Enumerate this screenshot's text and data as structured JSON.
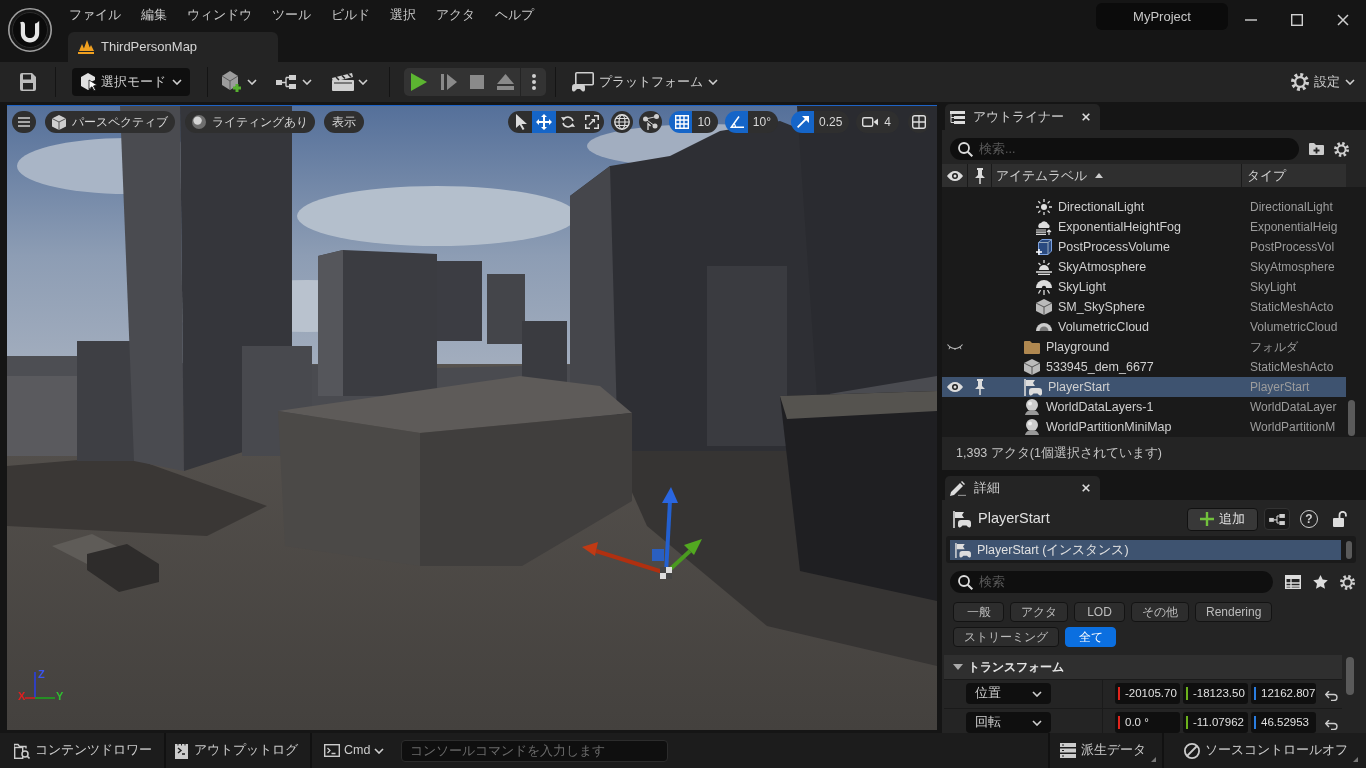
{
  "window": {
    "title": "MyProject",
    "menu": [
      "ファイル",
      "編集",
      "ウィンドウ",
      "ツール",
      "ビルド",
      "選択",
      "アクタ",
      "ヘルプ"
    ]
  },
  "document_tabs": [
    {
      "label": "ThirdPersonMap",
      "selected": true
    }
  ],
  "toolbar": {
    "mode": "選択モード",
    "platforms": "プラットフォーム",
    "settings": "設定"
  },
  "viewport": {
    "view_mode": "パースペクティブ",
    "lighting": "ライティングあり",
    "show": "表示",
    "tools": [
      {
        "kind": "select",
        "selected": false
      },
      {
        "kind": "move",
        "selected": true
      },
      {
        "kind": "rotate",
        "selected": false
      },
      {
        "kind": "scale",
        "selected": false
      }
    ],
    "grid_snap": {
      "on": true,
      "value": "10"
    },
    "angle_snap": {
      "on": true,
      "value": "10°"
    },
    "scale_snap": {
      "on": true,
      "value": "0.25"
    },
    "camera_speed": "4",
    "axes": {
      "x": "X",
      "y": "Y",
      "z": "Z"
    }
  },
  "outliner": {
    "tab": "アウトライナー",
    "search_placeholder": "検索...",
    "columns": [
      "アイテムラベル",
      "タイプ"
    ],
    "items": [
      {
        "children": [
          {
            "label": "DirectionalLight",
            "type": "DirectionalLight",
            "kind": "light",
            "selected": false,
            "hidden": false
          },
          {
            "label": "ExponentialHeightFog",
            "type": "ExponentialHeig",
            "kind": "fog",
            "selected": false,
            "hidden": false
          },
          {
            "label": "PostProcessVolume",
            "type": "PostProcessVol",
            "kind": "volume",
            "selected": false,
            "hidden": false
          },
          {
            "label": "SkyAtmosphere",
            "type": "SkyAtmosphere",
            "kind": "atmosphere",
            "selected": false,
            "hidden": false
          },
          {
            "label": "SkyLight",
            "type": "SkyLight",
            "kind": "skylight",
            "selected": false,
            "hidden": false
          },
          {
            "label": "SM_SkySphere",
            "type": "StaticMeshActo",
            "kind": "mesh",
            "selected": false,
            "hidden": false
          },
          {
            "label": "VolumetricCloud",
            "type": "VolumetricCloud",
            "kind": "cloud",
            "selected": false,
            "hidden": false
          }
        ]
      },
      {
        "label": "Playground",
        "type": "フォルダ",
        "kind": "folder",
        "selected": false,
        "hidden": true
      },
      {
        "label": "533945_dem_6677",
        "type": "StaticMeshActo",
        "kind": "mesh",
        "selected": false,
        "hidden": false
      },
      {
        "label": "PlayerStart",
        "type": "PlayerStart",
        "kind": "playerstart",
        "selected": true,
        "hidden": false
      },
      {
        "label": "WorldDataLayers-1",
        "type": "WorldDataLayer",
        "kind": "datalayer",
        "selected": false,
        "hidden": false
      },
      {
        "label": "WorldPartitionMiniMap",
        "type": "WorldPartitionM",
        "kind": "datalayer",
        "selected": false,
        "hidden": false
      }
    ],
    "status": "1,393 アクタ(1個選択されています)"
  },
  "details": {
    "tab": "詳細",
    "actor": "PlayerStart",
    "add_button": "追加",
    "help": "?",
    "components": [
      {
        "label": "PlayerStart (インスタンス)",
        "selected": true
      }
    ],
    "search_placeholder": "検索",
    "filters": [
      {
        "label": "一般",
        "selected": false
      },
      {
        "label": "アクタ",
        "selected": false
      },
      {
        "label": "LOD",
        "selected": false
      },
      {
        "label": "その他",
        "selected": false
      },
      {
        "label": "Rendering",
        "selected": false
      },
      {
        "label": "ストリーミング",
        "selected": false
      },
      {
        "label": "全て",
        "selected": true
      }
    ],
    "section": {
      "title": "トランスフォーム",
      "expanded": true
    },
    "properties": [
      {
        "label": "位置",
        "values": [
          {
            "value": "-20105.70",
            "color": "#e0241c"
          },
          {
            "value": "-18123.50",
            "color": "#6cb21c"
          },
          {
            "value": "12162.807",
            "color": "#2a7de0"
          }
        ]
      },
      {
        "label": "回転",
        "values": [
          {
            "value": "0.0 °",
            "color": "#e0241c"
          },
          {
            "value": "-11.07962",
            "color": "#6cb21c"
          },
          {
            "value": "46.52953",
            "color": "#2a7de0"
          }
        ]
      }
    ]
  },
  "status_bar": {
    "content_drawer": "コンテンツドロワー",
    "output_log": "アウトプットログ",
    "cmd": "Cmd",
    "console_placeholder": "コンソールコマンドを入力します",
    "derived_data": "派生データ",
    "source_control": "ソースコントロールオフ"
  }
}
